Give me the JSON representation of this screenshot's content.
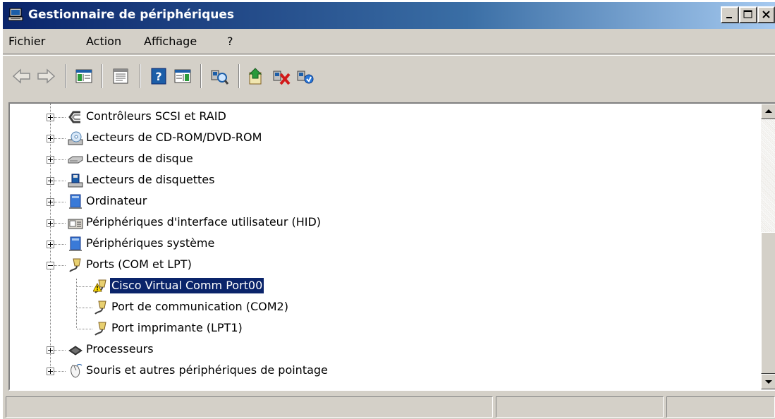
{
  "window": {
    "title": "Gestionnaire de périphériques",
    "controls": [
      "minimize",
      "maximize",
      "close"
    ]
  },
  "menu": {
    "items": [
      "Fichier",
      "Action",
      "Affichage",
      "?"
    ]
  },
  "toolbar": {
    "buttons": [
      "back-icon",
      "forward-icon",
      "console-tree-icon",
      "properties-icon",
      "help-icon",
      "action-pane-icon",
      "scan-hardware-icon",
      "update-driver-icon",
      "uninstall-icon",
      "disable-icon"
    ]
  },
  "tree": {
    "items": [
      {
        "label": "Contrôleurs SCSI et RAID",
        "icon": "scsi-controller-icon",
        "expanded": false
      },
      {
        "label": "Lecteurs de CD-ROM/DVD-ROM",
        "icon": "cdrom-icon",
        "expanded": false
      },
      {
        "label": "Lecteurs de disque",
        "icon": "disk-drive-icon",
        "expanded": false
      },
      {
        "label": "Lecteurs de disquettes",
        "icon": "floppy-drive-icon",
        "expanded": false
      },
      {
        "label": "Ordinateur",
        "icon": "computer-icon",
        "expanded": false
      },
      {
        "label": "Périphériques d'interface utilisateur (HID)",
        "icon": "hid-icon",
        "expanded": false
      },
      {
        "label": "Périphériques système",
        "icon": "system-devices-icon",
        "expanded": false
      },
      {
        "label": "Ports (COM et LPT)",
        "icon": "port-icon",
        "expanded": true
      },
      {
        "label": "Cisco Virtual Comm Port00",
        "icon": "port-warning-icon",
        "child": true,
        "selected": true
      },
      {
        "label": "Port de communication (COM2)",
        "icon": "port-icon",
        "child": true
      },
      {
        "label": "Port imprimante (LPT1)",
        "icon": "port-icon",
        "child": true
      },
      {
        "label": "Processeurs",
        "icon": "processor-icon",
        "expanded": false
      },
      {
        "label": "Souris et autres périphériques de pointage",
        "icon": "mouse-icon",
        "expanded": false
      }
    ]
  },
  "statusbar": {
    "panes": [
      "",
      "",
      ""
    ]
  },
  "colors": {
    "titlebar_start": "#0a246a",
    "titlebar_end": "#a6caf0",
    "chrome": "#d4d0c8",
    "selection": "#0a246a"
  }
}
